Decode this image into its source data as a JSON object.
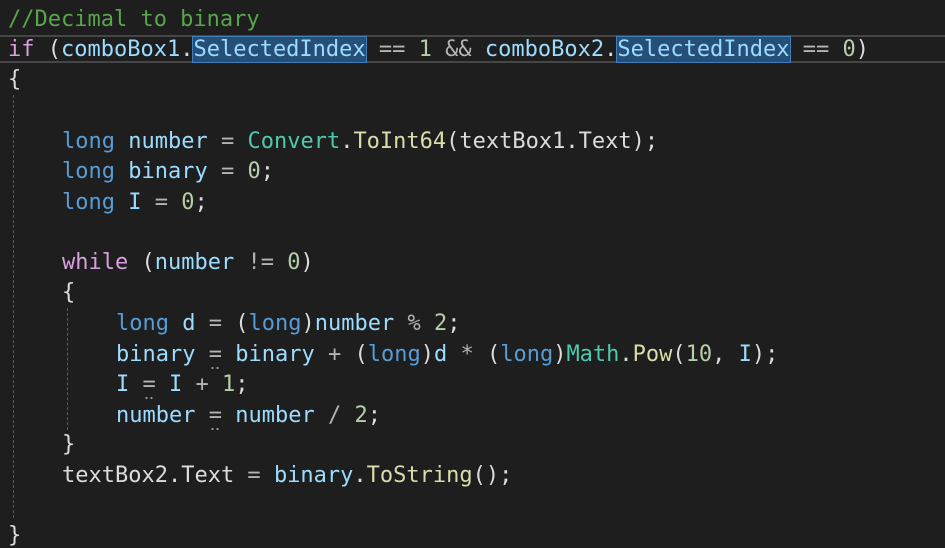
{
  "theme": {
    "background": "#1e1e1e",
    "comment": "#57a64a",
    "keyword": "#569cd6",
    "control": "#d8a0df",
    "variable": "#9cdcfe",
    "type": "#4ec9b0",
    "method": "#dcdcaa",
    "number": "#b5cea8",
    "selection": "#264f78"
  },
  "code": {
    "comment": "//Decimal to binary",
    "if_kw": "if",
    "open_paren": " (",
    "combo1": "comboBox1",
    "combo2": "comboBox2",
    "dot": ".",
    "selected_index": "SelectedIndex",
    "eq": " == ",
    "one": "1",
    "and": " && ",
    "zero": "0",
    "close_paren": ")",
    "brace_open": "{",
    "brace_close": "}",
    "long_kw": "long",
    "number_var": "number",
    "binary_var": "binary",
    "i_var": "I",
    "d_var": "d",
    "assign": " = ",
    "convert_type": "Convert",
    "toint64": "ToInt64",
    "textbox1_text": "(textBox1.Text);",
    "semicolon": ";",
    "while_kw": "while",
    "neq": " != ",
    "mod": " % ",
    "two": "2",
    "plus": " + ",
    "star": " * ",
    "slash": " / ",
    "math_type": "Math",
    "pow_method": "Pow",
    "ten": "10",
    "comma": ", ",
    "textbox2_text": "textBox2.Text",
    "tostring_method": "ToString",
    "call_end": "();"
  }
}
